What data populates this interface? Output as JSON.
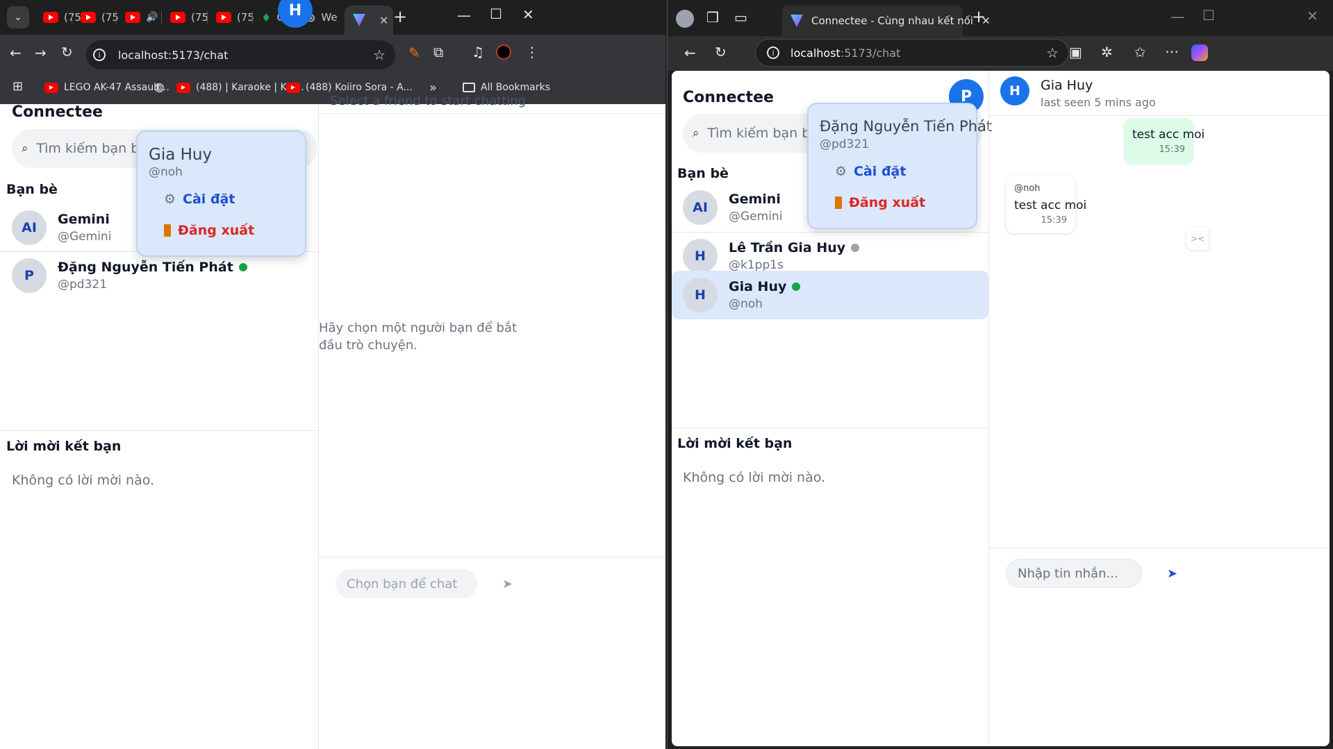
{
  "left_browser": {
    "tabs": [
      {
        "label": "(75",
        "icon": "youtube-icon"
      },
      {
        "label": "(75",
        "icon": "youtube-icon"
      },
      {
        "label": "",
        "icon": "speaker-icon"
      },
      {
        "label": "(75",
        "icon": "youtube-icon"
      },
      {
        "label": "(75",
        "icon": "youtube-icon"
      },
      {
        "label": "Co",
        "icon": "leaf-icon"
      },
      {
        "label": "We",
        "icon": "openai-icon"
      },
      {
        "label": "",
        "icon": "vite-icon"
      }
    ],
    "url": "localhost:5173/chat",
    "bookmarks": [
      {
        "label": "LEGO AK-47 Assault..."
      },
      {
        "label": "(488) | Karaoke | Koi..."
      },
      {
        "label": "(488) Koiiro Sora - A..."
      }
    ],
    "all_bookmarks": "All Bookmarks",
    "more_bookmarks": "»"
  },
  "left_app": {
    "title": "Connectee",
    "user_avatar": "H",
    "search_placeholder": "Tìm kiếm bạn bè",
    "friends_heading": "Bạn bè",
    "friends": [
      {
        "avatar": "AI",
        "name": "Gemini",
        "handle": "@Gemini"
      },
      {
        "avatar": "P",
        "name": "Đặng Nguyễn Tiến Phát",
        "handle": "@pd321",
        "status": "online"
      }
    ],
    "popup": {
      "name": "Gia Huy",
      "handle": "@noh",
      "settings": "Cài đặt",
      "logout": "Đăng xuất"
    },
    "requests_heading": "Lời mời kết bạn",
    "requests_empty": "Không có lời mời nào.",
    "chat_header": "Select a friend to start chatting",
    "chat_empty": "Hãy chọn một người bạn để bắt đầu trò chuyện.",
    "chat_input_placeholder": "Chọn bạn để chat",
    "send_icon": "➤"
  },
  "right_browser": {
    "tab_title": "Connectee - Cùng nhau kết nối",
    "url_host": "localhost",
    "url_rest": ":5173/chat"
  },
  "right_app": {
    "title": "Connectee",
    "user_avatar": "P",
    "search_placeholder": "Tìm kiếm bạn bè",
    "friends_heading": "Bạn bè",
    "friends": [
      {
        "avatar": "AI",
        "name": "Gemini",
        "handle": "@Gemini"
      },
      {
        "avatar": "H",
        "name": "Lê Trần Gia Huy",
        "handle": "@k1pp1s",
        "status": "offline"
      },
      {
        "avatar": "H",
        "name": "Gia Huy",
        "handle": "@noh",
        "status": "online",
        "selected": true
      }
    ],
    "popup": {
      "name": "Đặng Nguyễn Tiến Phát",
      "handle": "@pd321",
      "settings": "Cài đặt",
      "logout": "Đăng xuất"
    },
    "requests_heading": "Lời mời kết bạn",
    "requests_empty": "Không có lời mời nào.",
    "chat": {
      "avatar": "H",
      "name": "Gia Huy",
      "status": "last seen 5 mins ago",
      "messages": [
        {
          "direction": "outgoing",
          "text": "test acc moi",
          "time": "15:39"
        },
        {
          "direction": "incoming",
          "sender": "@noh",
          "text": "test acc moi",
          "time": "15:39"
        }
      ],
      "input_placeholder": "Nhập tin nhắn...",
      "send_icon": "➤"
    }
  },
  "colors": {
    "accent": "#1a73e8",
    "selected_row": "#dbe8fb",
    "outgoing_bubble": "#dcfce7",
    "online": "#16a34a",
    "offline": "#9ca3af",
    "logout": "#dc2626"
  }
}
